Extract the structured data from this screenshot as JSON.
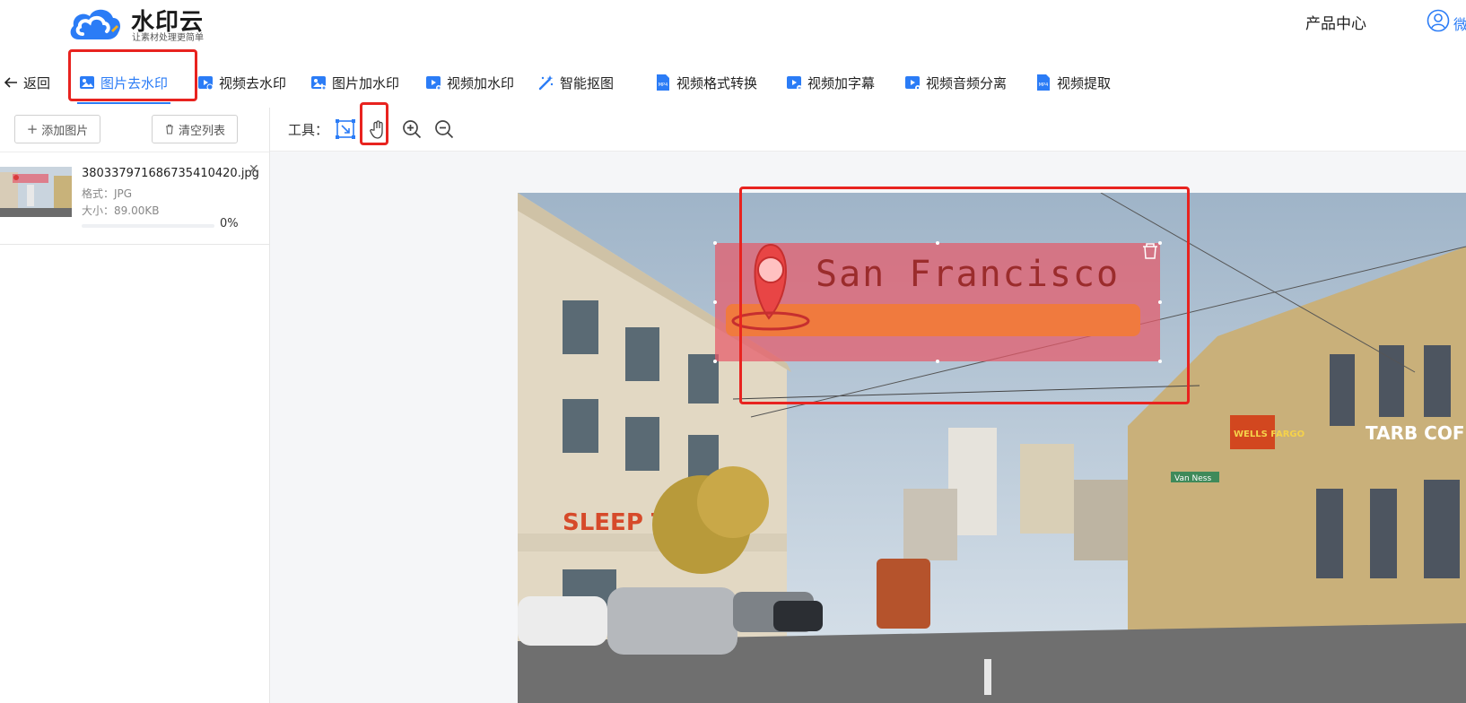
{
  "header": {
    "brand_name": "水印云",
    "brand_slogan": "让素材处理更简单",
    "product_center": "产品中心",
    "user_text": "微"
  },
  "nav": {
    "back_label": "返回",
    "tabs": [
      {
        "label": "图片去水印",
        "icon": "image-icon",
        "active": true
      },
      {
        "label": "视频去水印",
        "icon": "video-icon",
        "active": false
      },
      {
        "label": "图片加水印",
        "icon": "image-add-icon",
        "active": false
      },
      {
        "label": "视频加水印",
        "icon": "video-add-icon",
        "active": false
      },
      {
        "label": "智能抠图",
        "icon": "magic-wand-icon",
        "active": false
      },
      {
        "label": "视频格式转换",
        "icon": "mp4-file-icon",
        "active": false
      },
      {
        "label": "视频加字幕",
        "icon": "video-subtitle-icon",
        "active": false
      },
      {
        "label": "视频音频分离",
        "icon": "video-audio-icon",
        "active": false
      },
      {
        "label": "视频提取",
        "icon": "mp4-file-icon",
        "active": false
      }
    ]
  },
  "sidebar": {
    "add_image_label": "添加图片",
    "clear_list_label": "清空列表",
    "files": [
      {
        "name": "380337971686735410420.jpg",
        "format": "格式：JPG",
        "size": "大小：89.00KB",
        "progress": 0,
        "progress_text": "0%"
      }
    ]
  },
  "workspace": {
    "tools_label": "工具：",
    "tools": [
      "select-area-icon",
      "hand-pan-icon",
      "zoom-in-icon",
      "zoom-out-icon"
    ],
    "image": {
      "overlay_text": "San Francisco",
      "shop_sign_1": "SLEEP TRA",
      "shop_sign_2": "WELLS FARGO",
      "shop_sign_3": "TARB COF",
      "street_sign": "Van Ness",
      "overlay_tint": "#e65a6a",
      "overlay_bar": "#f07a3e"
    }
  },
  "colors": {
    "accent": "#2b7cf6",
    "highlight_red": "#e8231f"
  }
}
